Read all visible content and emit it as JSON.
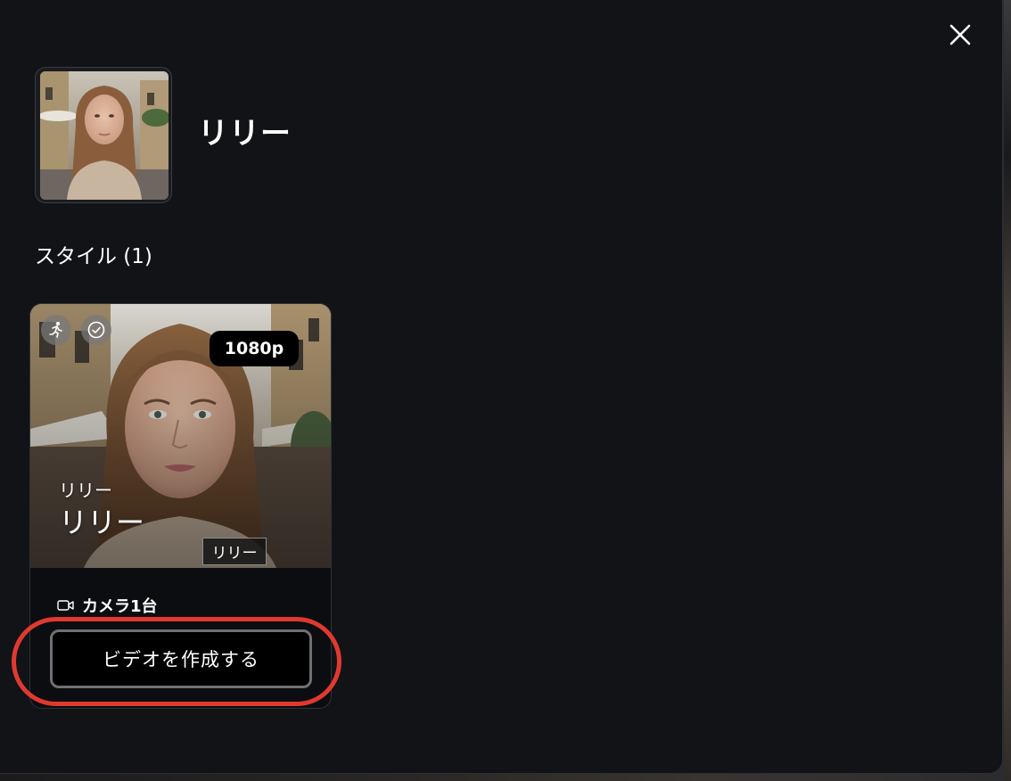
{
  "dialog": {
    "close_icon": "close-icon"
  },
  "profile": {
    "name": "リリー"
  },
  "styles_section": {
    "title": "スタイル (1)"
  },
  "style_card": {
    "icons": [
      "running-figure-icon",
      "check-circle-icon"
    ],
    "resolution_badge": "1080p",
    "overlay_small_text": "リリー",
    "overlay_large_text": "リリー",
    "overlay_tag_text": "リリー",
    "camera_icon": "video-camera-icon",
    "camera_label": "カメラ1台",
    "create_button_label": "ビデオを作成する"
  },
  "colors": {
    "modal_background": "#111317",
    "highlight_ring": "#e0392f",
    "button_background": "#000000"
  }
}
